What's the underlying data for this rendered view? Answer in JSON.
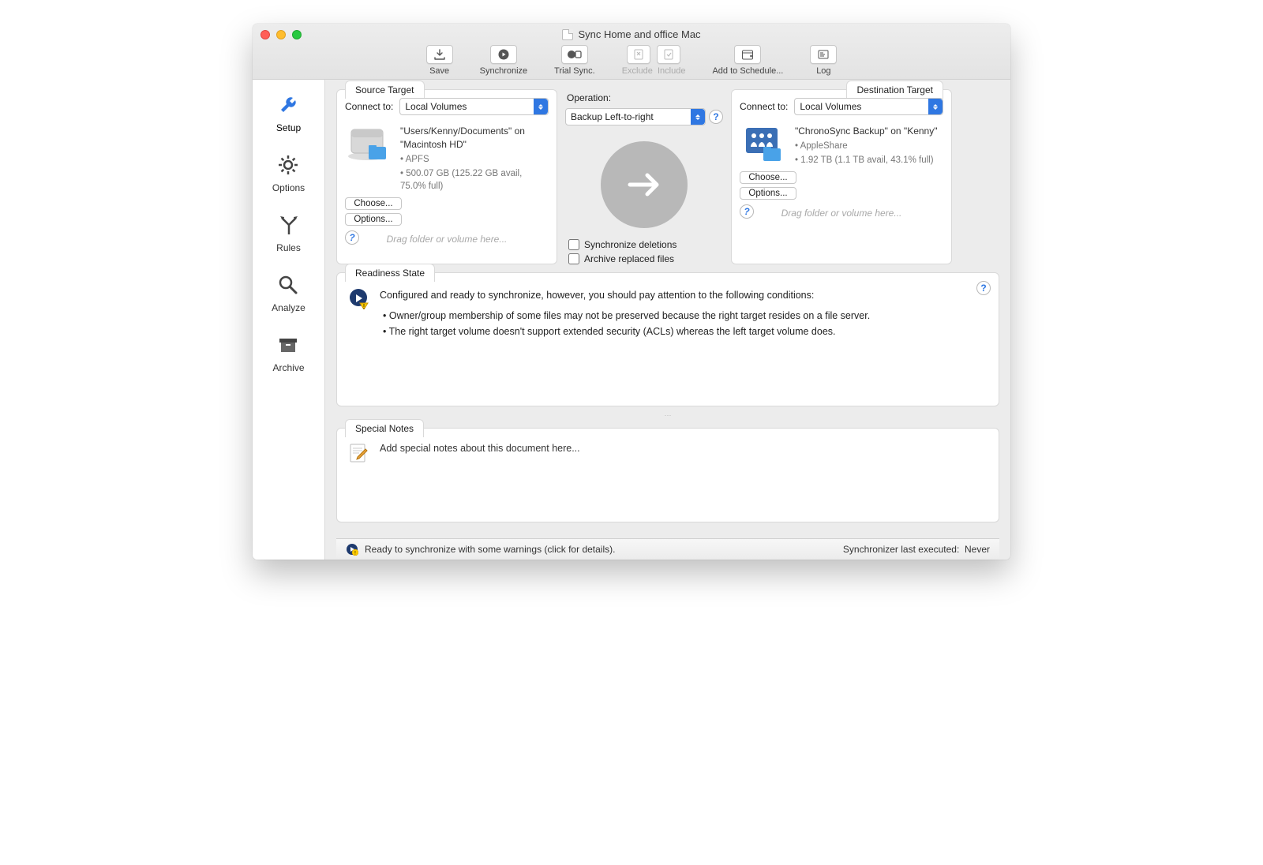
{
  "window_title": "Sync Home and office Mac",
  "toolbar": {
    "save": "Save",
    "synchronize": "Synchronize",
    "trial": "Trial Sync.",
    "exclude": "Exclude",
    "include": "Include",
    "schedule": "Add to Schedule...",
    "log": "Log"
  },
  "sidebar": {
    "setup": "Setup",
    "options": "Options",
    "rules": "Rules",
    "analyze": "Analyze",
    "archive": "Archive"
  },
  "source": {
    "tab": "Source Target",
    "connect_label": "Connect to:",
    "connect_value": "Local Volumes",
    "path": "\"Users/Kenny/Documents\" on \"Macintosh HD\"",
    "fs": "APFS",
    "size": "500.07 GB (125.22 GB avail, 75.0% full)",
    "choose": "Choose...",
    "options": "Options...",
    "hint": "Drag folder or volume here..."
  },
  "operation": {
    "label": "Operation:",
    "value": "Backup Left-to-right",
    "sync_deletions": "Synchronize deletions",
    "archive_replaced": "Archive replaced files"
  },
  "destination": {
    "tab": "Destination Target",
    "connect_label": "Connect to:",
    "connect_value": "Local Volumes",
    "path": "\"ChronoSync Backup\" on \"Kenny\"",
    "fs": "AppleShare",
    "size": "1.92 TB (1.1 TB avail, 43.1% full)",
    "choose": "Choose...",
    "options": "Options...",
    "hint": "Drag folder or volume here..."
  },
  "readiness": {
    "tab": "Readiness State",
    "summary": "Configured and ready to synchronize, however, you should pay attention to the following conditions:",
    "cond1": "Owner/group membership of some files may not be preserved because the right target resides on a file server.",
    "cond2": "The right target volume doesn't support extended security (ACLs) whereas the left target volume does."
  },
  "notes": {
    "tab": "Special Notes",
    "placeholder": "Add special notes about this document here..."
  },
  "status": {
    "left": "Ready to synchronize with some warnings (click for details).",
    "right_label": "Synchronizer last executed:",
    "right_value": "Never"
  }
}
